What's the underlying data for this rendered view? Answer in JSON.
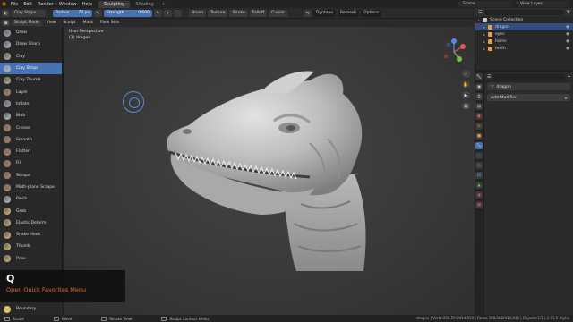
{
  "menubar": {
    "menus": [
      "File",
      "Edit",
      "Render",
      "Window",
      "Help"
    ],
    "workspaces": [
      {
        "label": "Sculpting",
        "active": true
      },
      {
        "label": "Shading",
        "active": false
      }
    ],
    "scene": "Scene",
    "view_layer": "View Layer"
  },
  "tool_header": {
    "active_tool": "Clay Strips",
    "radius_label": "Radius",
    "radius_value": "73 px",
    "strength_label": "Strength",
    "strength_value": "0.600",
    "menus": [
      "Brush",
      "Texture",
      "Stroke",
      "Falloff",
      "Cursor"
    ],
    "dyntopo": "Dyntopo",
    "remesh": "Remesh",
    "options": "Options"
  },
  "mode_header": {
    "mode": "Sculpt Mode",
    "menus": [
      "View",
      "Sculpt",
      "Mask",
      "Face Sets"
    ]
  },
  "tools": [
    {
      "label": "Draw",
      "color": "#9ab0c8"
    },
    {
      "label": "Draw Sharp",
      "color": "#c9c9c9"
    },
    {
      "label": "Clay",
      "color": "#c6b38c"
    },
    {
      "label": "Clay Strips",
      "color": "#c6b38c",
      "active": true
    },
    {
      "label": "Clay Thumb",
      "color": "#c6b38c"
    },
    {
      "label": "Layer",
      "color": "#c47f5d"
    },
    {
      "label": "Inflate",
      "color": "#9ab0c8"
    },
    {
      "label": "Blob",
      "color": "#c9c9c9"
    },
    {
      "label": "Crease",
      "color": "#c47f5d"
    },
    {
      "label": "Smooth",
      "color": "#c47f5d"
    },
    {
      "label": "Flatten",
      "color": "#c47f5d"
    },
    {
      "label": "Fill",
      "color": "#c47f5d"
    },
    {
      "label": "Scrape",
      "color": "#c47f5d"
    },
    {
      "label": "Multi-plane Scrape",
      "color": "#c47f5d"
    },
    {
      "label": "Pinch",
      "color": "#c9c9c9"
    },
    {
      "label": "Grab",
      "color": "#e0c26a"
    },
    {
      "label": "Elastic Deform",
      "color": "#e0c26a"
    },
    {
      "label": "Snake Hook",
      "color": "#e0c26a"
    },
    {
      "label": "Thumb",
      "color": "#e0c26a"
    },
    {
      "label": "Pose",
      "color": "#e0c26a"
    }
  ],
  "bottom_tool": {
    "label": "Boundary"
  },
  "viewport": {
    "view_name": "User Perspective",
    "object_name": "(1) dragon"
  },
  "overlay": {
    "key": "Q",
    "text": "Open Quick Favorites Menu"
  },
  "outliner": {
    "rows": [
      {
        "label": "Scene Collection",
        "icon_color": "#cfcfcf",
        "indent": 0,
        "selected": false
      },
      {
        "label": "dragon",
        "icon_color": "#e0a050",
        "indent": 1,
        "selected": true
      },
      {
        "label": "eyes",
        "icon_color": "#e0a050",
        "indent": 1,
        "selected": false
      },
      {
        "label": "horns",
        "icon_color": "#e0a050",
        "indent": 1,
        "selected": false
      },
      {
        "label": "teeth",
        "icon_color": "#e0a050",
        "indent": 1,
        "selected": false
      }
    ]
  },
  "properties": {
    "object_field": "dragon",
    "add_modifier": "Add Modifier"
  },
  "statusbar": {
    "items": [
      "Sculpt",
      "Move",
      "Rotate View",
      "Sculpt Context Menu"
    ],
    "stats": "dragon | Verts:398,594/414,930 | Faces:398,582/414,846 | Objects:1/1 | 2.93.0 Alpha"
  },
  "colors": {
    "accent": "#4772b3",
    "blender_orange": "#e87d0d",
    "overlay_text": "#e8683a"
  }
}
